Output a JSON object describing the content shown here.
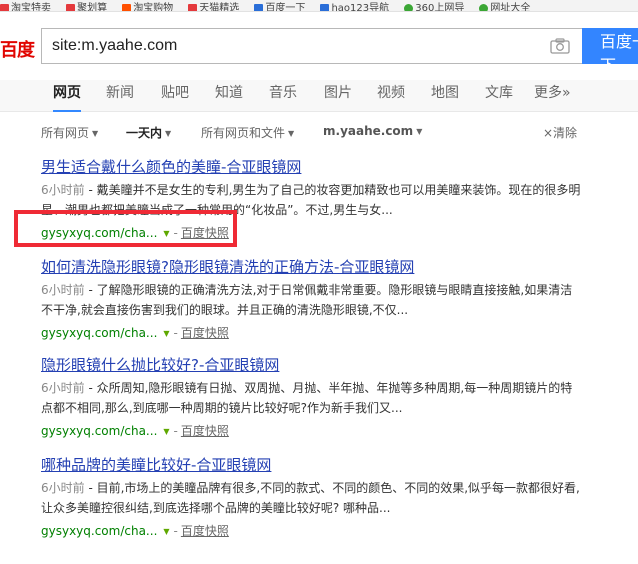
{
  "bookmarks": [
    {
      "label": "淘宝特卖",
      "color": "#e4393c"
    },
    {
      "label": "聚划算",
      "color": "#e4393c"
    },
    {
      "label": "淘宝购物",
      "color": "#ff5000"
    },
    {
      "label": "天猫精选",
      "color": "#e4393c"
    },
    {
      "label": "百度一下",
      "color": "#2a6ed8"
    },
    {
      "label": "hao123导航",
      "color": "#2a6ed8"
    },
    {
      "label": "360上网导",
      "color": "#3ba635"
    },
    {
      "label": "网址大全",
      "color": "#3ba635"
    }
  ],
  "header": {
    "logo": "百度",
    "search_value": "site:m.yaahe.com",
    "search_button": "百度一下"
  },
  "nav": {
    "tabs": [
      "网页",
      "新闻",
      "贴吧",
      "知道",
      "音乐",
      "图片",
      "视频",
      "地图",
      "文库",
      "更多»"
    ],
    "active": "网页"
  },
  "filters": {
    "all_pages": "所有网页",
    "time": "一天内",
    "file_type": "所有网页和文件",
    "site": "m.yaahe.com",
    "clear": "×清除"
  },
  "results": [
    {
      "title": "男生适合戴什么颜色的美瞳-合亚眼镜网",
      "time": "6小时前",
      "snippet": "戴美瞳并不是女生的专利,男生为了自己的妆容更加精致也可以用美瞳来装饰。现在的很多明星、潮男也都把美瞳当成了一种常用的“化妆品”。不过,男生与女...",
      "url": "gysyxyq.com/cha...",
      "cache": "百度快照"
    },
    {
      "title": "如何清洗隐形眼镜?隐形眼镜清洗的正确方法-合亚眼镜网",
      "time": "6小时前",
      "snippet": "了解隐形眼镜的正确清洗方法,对于日常佩戴非常重要。隐形眼镜与眼睛直接接触,如果清洁不干净,就会直接伤害到我们的眼球。并且正确的清洗隐形眼镜,不仅...",
      "url": "gysyxyq.com/cha...",
      "cache": "百度快照"
    },
    {
      "title": "隐形眼镜什么抛比较好?-合亚眼镜网",
      "time": "6小时前",
      "snippet": "众所周知,隐形眼镜有日抛、双周抛、月抛、半年抛、年抛等多种周期,每一种周期镜片的特点都不相同,那么,到底哪一种周期的镜片比较好呢?作为新手我们又...",
      "url": "gysyxyq.com/cha...",
      "cache": "百度快照"
    },
    {
      "title": "哪种品牌的美瞳比较好-合亚眼镜网",
      "time": "6小时前",
      "snippet": "目前,市场上的美瞳品牌有很多,不同的款式、不同的颜色、不同的效果,似乎每一款都很好看,让众多美瞳控很纠结,到底选择哪个品牌的美瞳比较好呢? 哪种品...",
      "url": "gysyxyq.com/cha...",
      "cache": "百度快照"
    }
  ]
}
